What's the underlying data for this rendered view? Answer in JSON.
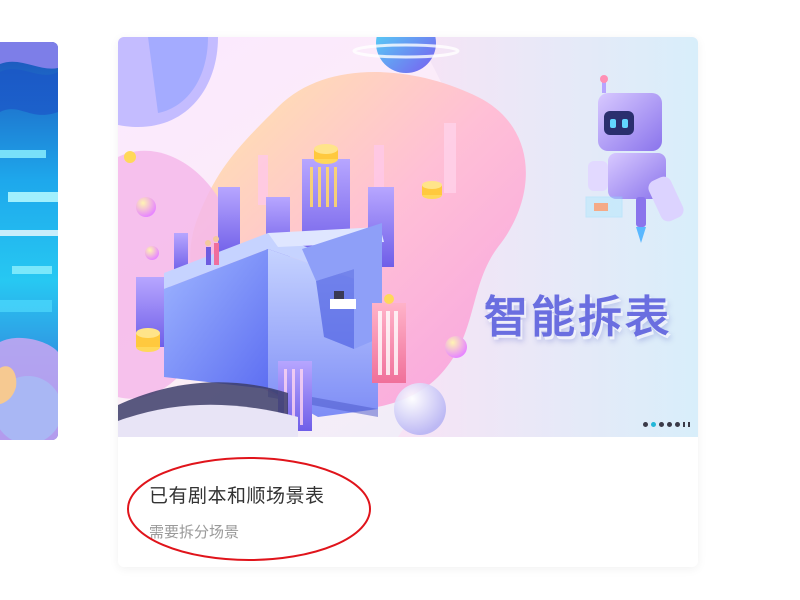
{
  "cards": [
    {
      "image_headline": "智能拆表",
      "title": "已有剧本和顺场景表",
      "subtitle": "需要拆分场景",
      "carousel_dots": 5,
      "active_dot_index": 1
    }
  ],
  "colors": {
    "title": "#333333",
    "subtitle": "#9a9a9a",
    "headline": "#6a6ee0",
    "annotation": "#e0141b",
    "active_dot": "#22b6d8"
  }
}
